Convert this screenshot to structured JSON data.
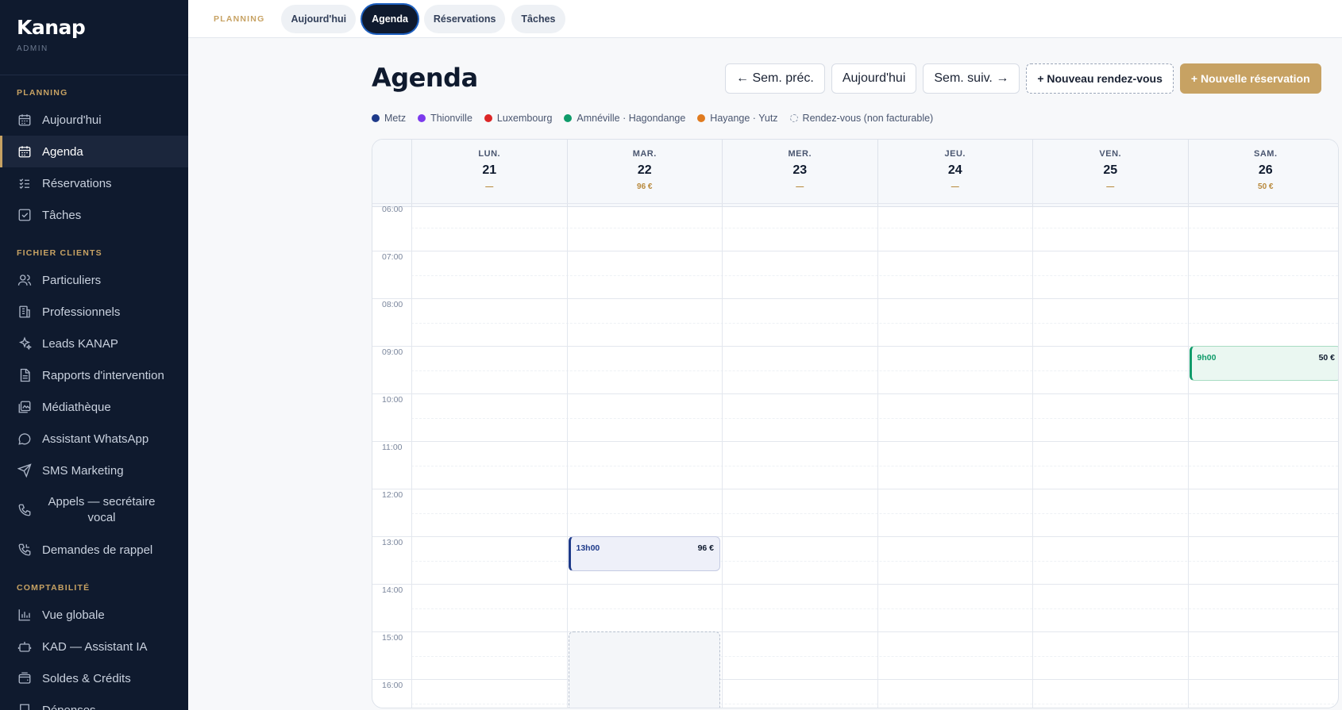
{
  "app": {
    "brand": "Kanap",
    "role": "ADMIN"
  },
  "sidebar": {
    "sections": [
      {
        "title": "PLANNING",
        "items": [
          {
            "label": "Aujourd'hui",
            "icon": "calendar-icon"
          },
          {
            "label": "Agenda",
            "icon": "calendar-grid-icon",
            "active": true
          },
          {
            "label": "Réservations",
            "icon": "list-check-icon"
          },
          {
            "label": "Tâches",
            "icon": "checkbox-icon"
          }
        ]
      },
      {
        "title": "FICHIER CLIENTS",
        "items": [
          {
            "label": "Particuliers",
            "icon": "users-icon"
          },
          {
            "label": "Professionnels",
            "icon": "building-icon"
          },
          {
            "label": "Leads KANAP",
            "icon": "sparkles-icon"
          },
          {
            "label": "Rapports d'intervention",
            "icon": "document-icon"
          },
          {
            "label": "Médiathèque",
            "icon": "image-gallery-icon"
          },
          {
            "label": "Assistant WhatsApp",
            "icon": "chat-bubble-icon"
          },
          {
            "label": "SMS Marketing",
            "icon": "send-icon"
          },
          {
            "label": "Appels — secrétaire vocal",
            "icon": "phone-icon"
          },
          {
            "label": "Demandes de rappel",
            "icon": "phone-callback-icon"
          }
        ]
      },
      {
        "title": "COMPTABILITÉ",
        "items": [
          {
            "label": "Vue globale",
            "icon": "bar-chart-icon"
          },
          {
            "label": "KAD — Assistant IA",
            "icon": "robot-icon"
          },
          {
            "label": "Soldes & Crédits",
            "icon": "wallet-icon"
          },
          {
            "label": "Dépenses",
            "icon": "receipt-icon"
          }
        ]
      }
    ]
  },
  "topbar": {
    "label": "PLANNING",
    "tabs": [
      "Aujourd'hui",
      "Agenda",
      "Réservations",
      "Tâches"
    ],
    "active_tab": "Agenda"
  },
  "page": {
    "title": "Agenda",
    "actions": {
      "prev": "← Sem. préc.",
      "today": "Aujourd'hui",
      "next": "Sem. suiv. →",
      "new_appointment": "+ Nouveau rendez-vous",
      "new_reservation": "+ Nouvelle réservation"
    }
  },
  "legend": [
    {
      "label": "Metz",
      "color": "#1e3a8a"
    },
    {
      "label": "Thionville",
      "color": "#7c3aed"
    },
    {
      "label": "Luxembourg",
      "color": "#dc2626"
    },
    {
      "label": "Amnéville · Hagondange",
      "color": "#0f9b6a"
    },
    {
      "label": "Hayange · Yutz",
      "color": "#e07b1f"
    },
    {
      "label": "Rendez-vous (non facturable)",
      "color": "dashed"
    }
  ],
  "calendar": {
    "days": [
      {
        "name": "LUN.",
        "num": "21",
        "total": "—"
      },
      {
        "name": "MAR.",
        "num": "22",
        "total": "96 €"
      },
      {
        "name": "MER.",
        "num": "23",
        "total": "—"
      },
      {
        "name": "JEU.",
        "num": "24",
        "total": "—"
      },
      {
        "name": "VEN.",
        "num": "25",
        "total": "—"
      },
      {
        "name": "SAM.",
        "num": "26",
        "total": "50 €"
      }
    ],
    "hours": [
      "06:00",
      "07:00",
      "08:00",
      "09:00",
      "10:00",
      "11:00",
      "12:00",
      "13:00",
      "14:00",
      "15:00",
      "16:00"
    ],
    "events": [
      {
        "day": 1,
        "time": "13h00",
        "price": "96 €",
        "region": "Metz",
        "start_hour": 13.0,
        "duration_h": 0.75
      },
      {
        "day": 5,
        "time": "9h00",
        "price": "50 €",
        "region": "Amnéville · Hagondange",
        "start_hour": 9.0,
        "duration_h": 0.75
      }
    ],
    "placeholders": [
      {
        "day": 1,
        "start_hour": 15.0
      }
    ]
  }
}
